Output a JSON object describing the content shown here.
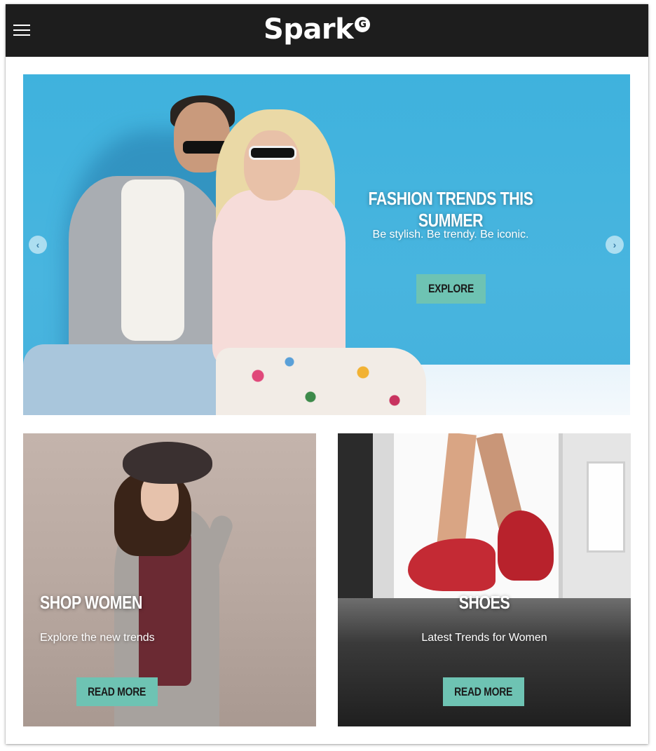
{
  "header": {
    "logo_text": "Spark",
    "logo_badge": "G",
    "menu_icon": "hamburger-icon"
  },
  "hero": {
    "title": "FASHION TRENDS THIS SUMMER",
    "subtitle": "Be stylish. Be trendy. Be iconic.",
    "button_label": "EXPLORE",
    "prev_icon": "chevron-left-icon",
    "next_icon": "chevron-right-icon",
    "prev_glyph": "‹",
    "next_glyph": "›"
  },
  "cards": [
    {
      "title": "SHOP WOMEN",
      "subtitle": "Explore the new trends",
      "button_label": "READ MORE"
    },
    {
      "title": "SHOES",
      "subtitle": "Latest Trends for Women",
      "button_label": "READ MORE"
    }
  ],
  "colors": {
    "topbar": "#1d1d1d",
    "accent_button": "#6ec3b3",
    "hero_background": "#45b1dc"
  }
}
